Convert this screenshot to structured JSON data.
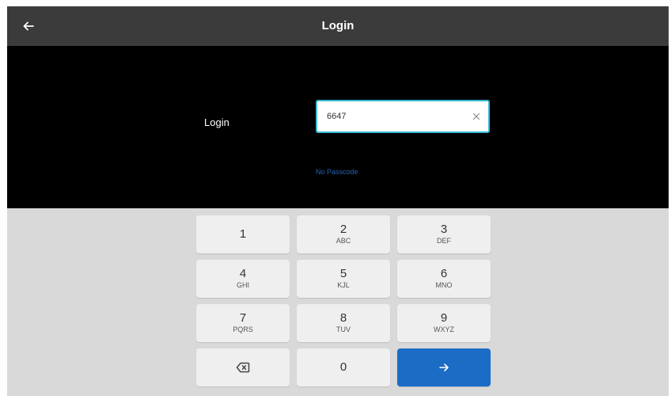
{
  "header": {
    "title": "Login",
    "back_icon": "arrow-left-icon"
  },
  "form": {
    "label": "Login",
    "input_value": "6647",
    "clear_icon": "close-icon",
    "link_label": "No Passcode"
  },
  "keypad": {
    "keys": [
      {
        "digit": "1",
        "letters": ""
      },
      {
        "digit": "2",
        "letters": "ABC"
      },
      {
        "digit": "3",
        "letters": "DEF"
      },
      {
        "digit": "4",
        "letters": "GHI"
      },
      {
        "digit": "5",
        "letters": "KJL"
      },
      {
        "digit": "6",
        "letters": "MNO"
      },
      {
        "digit": "7",
        "letters": "PQRS"
      },
      {
        "digit": "8",
        "letters": "TUV"
      },
      {
        "digit": "9",
        "letters": "WXYZ"
      }
    ],
    "zero": "0",
    "backspace_icon": "backspace-icon",
    "enter_icon": "arrow-right-icon"
  },
  "colors": {
    "header_bg": "#3b3b3b",
    "content_bg": "#000000",
    "keypad_bg": "#d9d9d9",
    "key_bg": "#efefef",
    "enter_bg": "#1b6cc5",
    "input_border": "#39b8d0",
    "link": "#2463b3"
  }
}
